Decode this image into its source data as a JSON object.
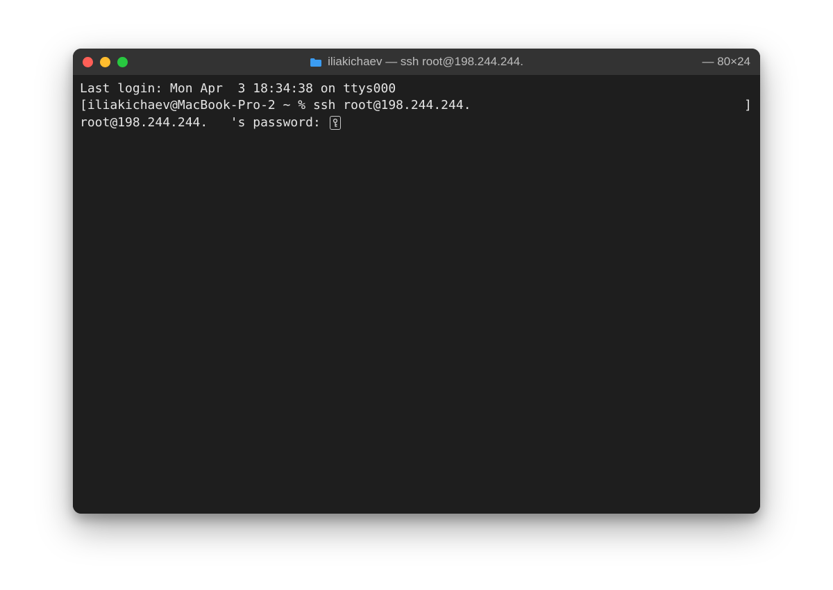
{
  "titlebar": {
    "title": "iliakichaev — ssh root@198.244.244.",
    "dimensions": "— 80×24"
  },
  "terminal": {
    "last_login": "Last login: Mon Apr  3 18:34:38 on ttys000",
    "prompt_open": "[",
    "prompt": "iliakichaev@MacBook-Pro-2 ~ % ",
    "command": "ssh root@198.244.244.",
    "prompt_close": "]",
    "password_prompt": "root@198.244.244.   's password: "
  }
}
